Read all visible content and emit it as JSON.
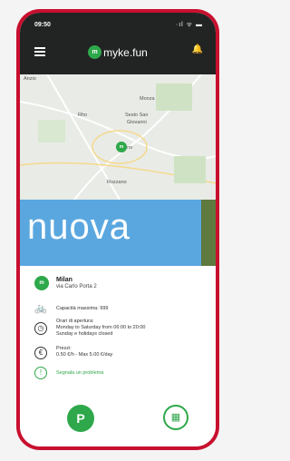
{
  "status": {
    "time": "09:50",
    "icons": "·ıl ᯤ ▬"
  },
  "header": {
    "brand_logo": "m",
    "brand": "myke.fun"
  },
  "map": {
    "labels": {
      "anzio": "Anzio",
      "monza": "Monza",
      "rho": "Rho",
      "sesto": "Sesto San",
      "giovanni": "Giovanni",
      "milano": "Milano",
      "rozzano": "Rozzano"
    },
    "pin": "m"
  },
  "banner": {
    "text": "nuova"
  },
  "station": {
    "logo": "m",
    "name": "Milan",
    "address": "via Carlo Porta 2",
    "capacity": "Capacità massima: 999",
    "hours_title": "Orari di apertura:",
    "hours_weekdays": "Monday to Saturday from 06:00 to 20:00",
    "hours_closed": "Sunday e holidays closed",
    "price_title": "Prezzi:",
    "price_value": "0.50 €/h - Max 5.00 €/day",
    "report": "Segnala un problema"
  },
  "actions": {
    "park": "P",
    "qr": "▦"
  },
  "icons": {
    "menu": "menu-icon",
    "bell": "bell-icon",
    "bike": "bike-icon",
    "clock": "clock-icon",
    "euro": "euro-icon",
    "alert": "alert-icon"
  },
  "colors": {
    "brand_green": "#2ea84a",
    "header_dark": "#222323",
    "banner_blue": "#5aa7e0",
    "phone_red": "#c8102e"
  }
}
